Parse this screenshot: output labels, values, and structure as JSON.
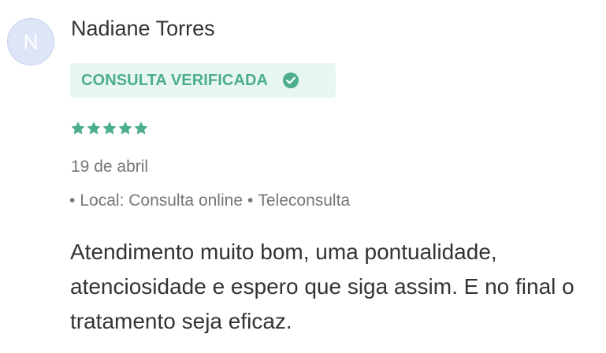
{
  "review": {
    "avatar_initial": "N",
    "author_name": "Nadiane Torres",
    "verified_label": "CONSULTA VERIFICADA",
    "rating": 5,
    "rating_max": 5,
    "date": "19 de abril",
    "meta": {
      "bullet": "•",
      "location": "Local: Consulta online",
      "visit_type": "Teleconsulta"
    },
    "text": "Atendimento muito bom, uma pontualidade, atenciosidade e espero que siga assim. E no final o tratamento seja eficaz."
  },
  "colors": {
    "accent": "#4cae8c",
    "badge_bg": "#e8f6f1",
    "avatar_bg": "#dde5f7",
    "muted_text": "#767676",
    "body_text": "#333333"
  },
  "icons": {
    "verified": "check-circle-icon",
    "rating": "star-icon"
  }
}
